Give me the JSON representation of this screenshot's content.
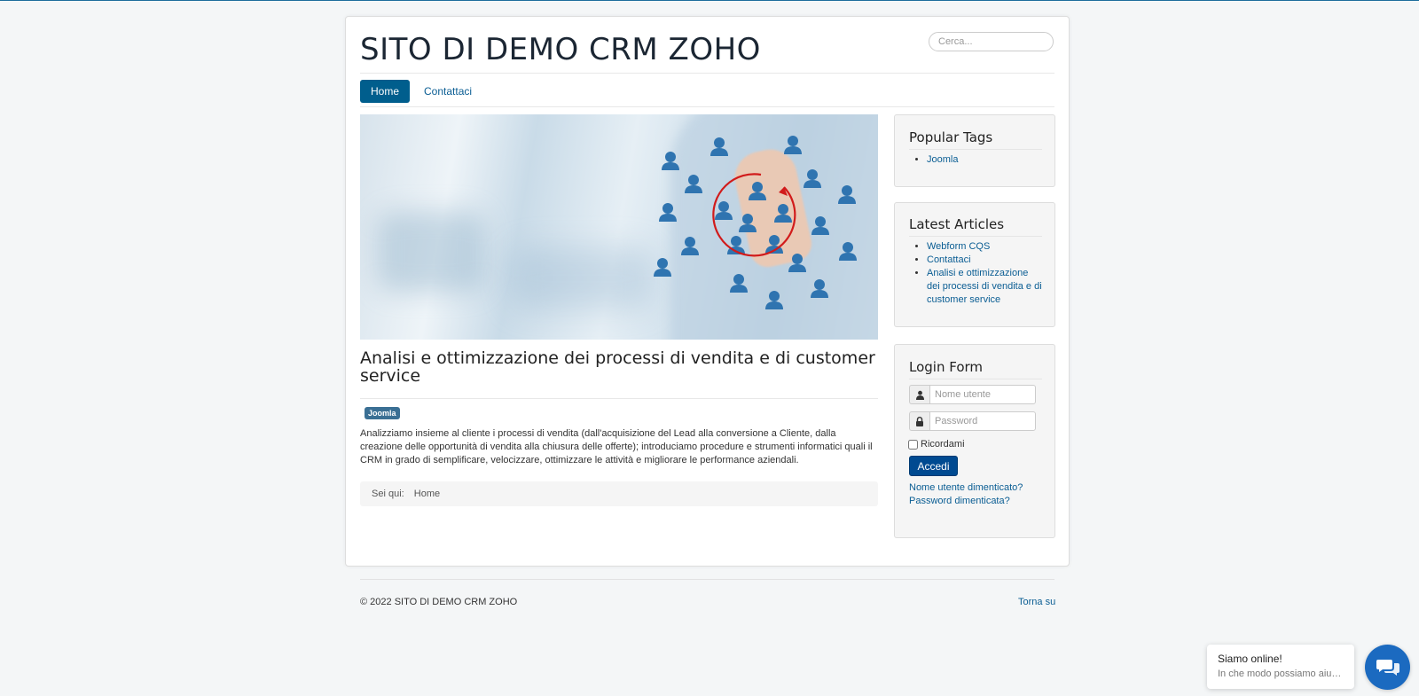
{
  "site": {
    "title": "SITO DI DEMO CRM ZOHO",
    "search_placeholder": "Cerca..."
  },
  "nav": {
    "items": [
      {
        "label": "Home",
        "active": true
      },
      {
        "label": "Contattaci",
        "active": false
      }
    ]
  },
  "hero": {
    "icon": "crm-people-network-image"
  },
  "article": {
    "title": "Analisi e ottimizzazione dei processi di vendita e di customer service",
    "tag": "Joomla",
    "body": "Analizziamo insieme al cliente i processi di vendita (dall'acquisizione del Lead alla conversione a Cliente, dalla creazione delle opportunità di vendita alla chiusura delle offerte); introduciamo procedure  e strumenti informatici quali il CRM in grado di semplificare, velocizzare, ottimizzare le attività e migliorare le performance aziendali."
  },
  "breadcrumb": {
    "label": "Sei qui:",
    "current": "Home"
  },
  "sidebar": {
    "popular_tags": {
      "title": "Popular Tags",
      "items": [
        "Joomla"
      ]
    },
    "latest_articles": {
      "title": "Latest Articles",
      "items": [
        "Webform CQS",
        "Contattaci",
        "Analisi e ottimizzazione dei processi di vendita e di customer service"
      ]
    },
    "login": {
      "title": "Login Form",
      "username_placeholder": "Nome utente",
      "password_placeholder": "Password",
      "remember_label": "Ricordami",
      "submit_label": "Accedi",
      "forgot_username": "Nome utente dimenticato?",
      "forgot_password": "Password dimenticata?",
      "icons": [
        "user-icon",
        "lock-icon"
      ]
    }
  },
  "footer": {
    "copyright": "© 2022 SITO DI DEMO CRM ZOHO",
    "back_to_top": "Torna su"
  },
  "chat": {
    "title": "Siamo online!",
    "subtitle": "In che modo possiamo aiu…",
    "icon": "chat-bubbles-icon"
  },
  "colors": {
    "accent": "#005e8d",
    "link": "#0a5d93",
    "button": "#004a91",
    "chat": "#1b6ac0"
  }
}
